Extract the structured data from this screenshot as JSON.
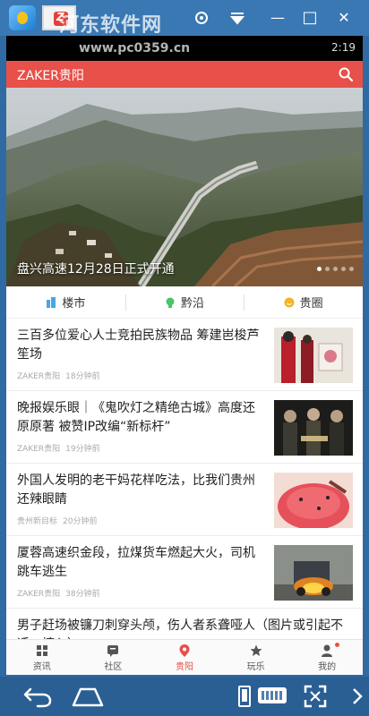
{
  "watermark": {
    "site_name": "河东软件网",
    "site_url": "www.pc0359.cn"
  },
  "window": {
    "controls": {
      "minimize": "—",
      "maximize": "□",
      "close": "✕"
    }
  },
  "status_bar": {
    "time": "2:19"
  },
  "app_bar": {
    "title": "ZAKER贵阳",
    "search_icon": "search-icon",
    "color": "#e8504a"
  },
  "hero": {
    "caption": "盘兴高速12月28日正式开通",
    "pages": 5,
    "active_page": 1
  },
  "categories": [
    {
      "label": "楼市",
      "icon": "building-icon",
      "color": "#4aa6e0"
    },
    {
      "label": "黔沿",
      "icon": "bulb-icon",
      "color": "#4cc36a"
    },
    {
      "label": "贵圈",
      "icon": "smiley-icon",
      "color": "#f5b324"
    }
  ],
  "news": [
    {
      "title": "三百多位爱心人士竞拍民族物品 筹建岜梭芦笙场",
      "source": "ZAKER贵阳",
      "time": "18分钟前"
    },
    {
      "title": "晚报娱乐眼｜《鬼吹灯之精绝古城》高度还原原著 被赞IP改编“新标杆”",
      "source": "ZAKER贵阳",
      "time": "19分钟前"
    },
    {
      "title": "外国人发明的老干妈花样吃法，比我们贵州还辣眼睛",
      "source": "贵州新目标",
      "time": "20分钟前"
    },
    {
      "title": "厦蓉高速织金段，拉煤货车燃起大火，司机跳车逃生",
      "source": "ZAKER贵阳",
      "time": "38分钟前"
    },
    {
      "title": "男子赶场被镰刀刺穿头颅，伤人者系聋哑人（图片或引起不适，慎入）",
      "source": "",
      "time": ""
    }
  ],
  "tabs": [
    {
      "label": "资讯",
      "icon": "grid-icon",
      "active": false
    },
    {
      "label": "社区",
      "icon": "community-icon",
      "active": false
    },
    {
      "label": "贵阳",
      "icon": "location-pin-icon",
      "active": true
    },
    {
      "label": "玩乐",
      "icon": "star-icon",
      "active": false
    },
    {
      "label": "我的",
      "icon": "profile-icon",
      "active": false,
      "badge": true
    }
  ],
  "emulator_nav": {
    "back": "back-icon",
    "home": "home-icon",
    "keyboard": "keyboard-icon",
    "fullscreen": "fullscreen-icon"
  }
}
